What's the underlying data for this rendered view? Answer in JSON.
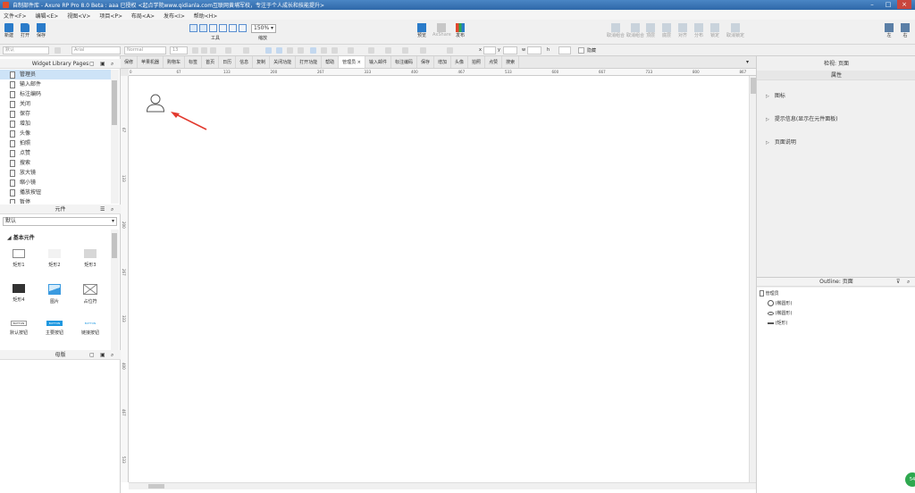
{
  "window": {
    "title": "自制部件库 - Axure RP Pro 8.0 Beta : aaa 已授权    <起点学院www.qidianla.com互联网黄埔军校，专注于个人成长和技能提升>"
  },
  "menu": [
    "文件<F>",
    "编辑<E>",
    "视图<V>",
    "项目<P>",
    "布局<A>",
    "发布<I>",
    "帮助<H>"
  ],
  "toolbar": {
    "new": "新建",
    "open": "打开",
    "save": "保存",
    "tools_label": "工具",
    "zoom_value": "150%",
    "zoom_label": "缩放",
    "preview": "预览",
    "share": "AxShare",
    "publish": "发布",
    "right_tools": [
      "取消组合",
      "取消组合",
      "顶层",
      "底层",
      "对齐",
      "分布",
      "锁定",
      "取消锁定"
    ],
    "left_panel": "左",
    "right_panel": "右"
  },
  "formatbar": {
    "style": "默认",
    "font": "Arial",
    "weight": "Normal",
    "size": "13",
    "x_label": "x",
    "y_label": "y",
    "w_label": "w",
    "h_label": "h",
    "hidden_label": "隐藏"
  },
  "pages_panel": {
    "title": "Widget Library Pages",
    "items": [
      "管理员",
      "输入邮件",
      "标注编码",
      "关闭",
      "保存",
      "增加",
      "头像",
      "拍照",
      "点赞",
      "搜索",
      "放大镜",
      "缩小镜",
      "播放按钮",
      "暂停"
    ],
    "selected": 0
  },
  "widgets_panel": {
    "title": "元件",
    "library": "默认",
    "group": "基本元件",
    "items": [
      "矩形1",
      "矩形2",
      "矩形3",
      "矩形4",
      "图片",
      "占位符",
      "默认按钮",
      "主要按钮",
      "链接按钮"
    ],
    "button_text": "BUTTON"
  },
  "masters_panel": {
    "title": "母版"
  },
  "tabs": [
    "保修",
    "苹果机器",
    "购物车",
    "标签",
    "首页",
    "日历",
    "信息",
    "复制",
    "关闭功能",
    "打开功能",
    "帮助",
    "管理员",
    "输入邮件",
    "标注编码",
    "保存",
    "增加",
    "头像",
    "拍照",
    "点赞",
    "搜索"
  ],
  "active_tab": 11,
  "ruler_h": [
    "0",
    "67",
    "133",
    "200",
    "267",
    "333",
    "400",
    "467",
    "533",
    "600",
    "667",
    "733",
    "800",
    "867"
  ],
  "ruler_v": [
    "67",
    "133",
    "200",
    "267",
    "333",
    "400",
    "467",
    "533"
  ],
  "inspector": {
    "title": "检视: 页面",
    "tab": "属性",
    "sections": [
      "图标",
      "提示信息(显示在元件面板)",
      "页面说明"
    ]
  },
  "outline": {
    "title": "Outline: 页面",
    "root": "管理员",
    "items": [
      "(椭圆形)",
      "(椭圆形)",
      "(矩形)"
    ]
  },
  "badge": "54"
}
